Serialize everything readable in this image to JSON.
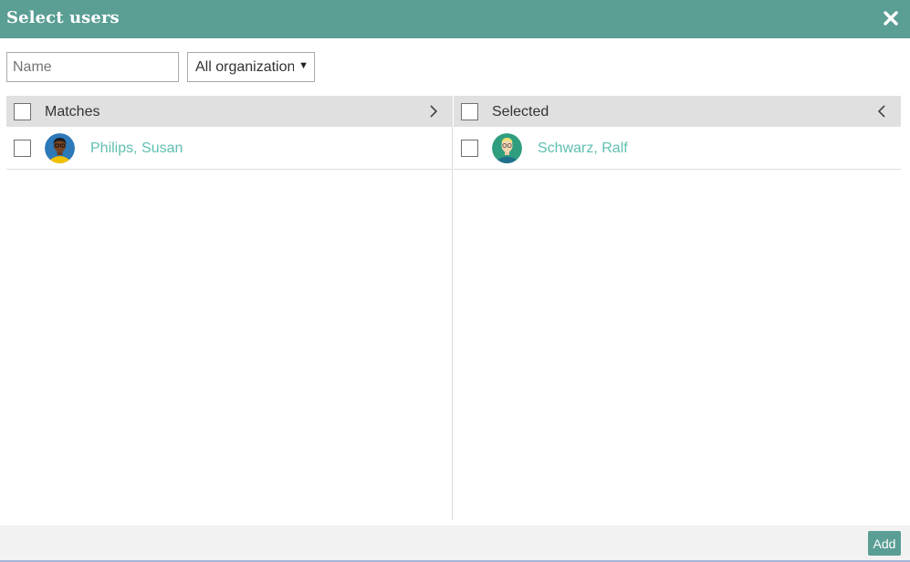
{
  "dialog": {
    "title": "Select users",
    "close_icon": "close-x-icon"
  },
  "filters": {
    "name_placeholder": "Name",
    "name_value": "",
    "organization_selected": "All organizations"
  },
  "matches": {
    "header_label": "Matches",
    "move_icon": "chevron-right-icon",
    "users": [
      {
        "name": "Philips, Susan",
        "avatar_icon": "avatar-woman-icon"
      }
    ]
  },
  "selected": {
    "header_label": "Selected",
    "move_icon": "chevron-left-icon",
    "users": [
      {
        "name": "Schwarz, Ralf",
        "avatar_icon": "avatar-man-glasses-icon"
      }
    ]
  },
  "footer": {
    "add_label": "Add"
  },
  "colors": {
    "accent": "#5a9e94",
    "link": "#5fbfb2",
    "header_bg": "#e0e0e0",
    "footer_bg": "#f2f2f2"
  }
}
